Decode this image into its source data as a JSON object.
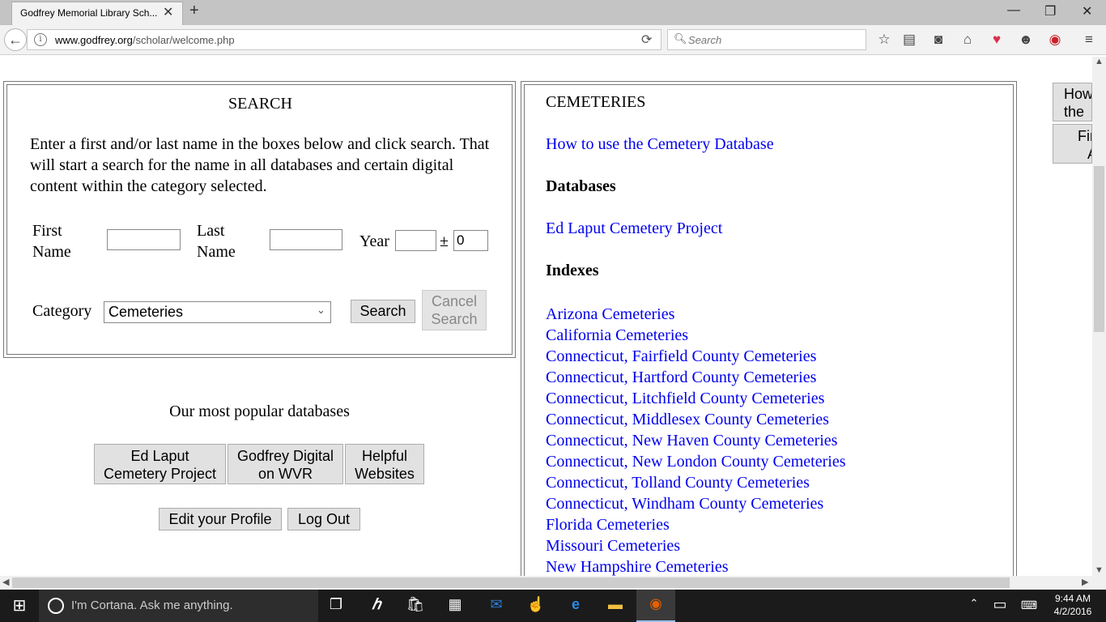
{
  "browser": {
    "tab_title": "Godfrey Memorial Library Sch...",
    "tab_close": "✕",
    "new_tab": "+",
    "url_domain": "www.godfrey.org",
    "url_path": "/scholar/welcome.php",
    "search_placeholder": "Search",
    "window_controls": {
      "minimize": "—",
      "restore": "❐",
      "close": "✕"
    }
  },
  "search_panel": {
    "title": "SEARCH",
    "instructions": "Enter a first and/or last name in the boxes below and click search. That will start a search for the name in all databases and certain digital content within the category selected.",
    "first_name_label_1": "First",
    "first_name_label_2": "Name",
    "first_name_value": "",
    "last_name_label_1": "Last",
    "last_name_label_2": "Name",
    "last_name_value": "",
    "year_label": "Year",
    "year_value": "",
    "plusminus": "±",
    "year_range_value": "0",
    "category_label": "Category",
    "category_selected": "Cemeteries",
    "search_button": "Search",
    "cancel_button_1": "Cancel",
    "cancel_button_2": "Search"
  },
  "popular": {
    "heading": "Our most popular databases",
    "btn1_line1": "Ed Laput",
    "btn1_line2": "Cemetery Project",
    "btn2_line1": "Godfrey Digital",
    "btn2_line2": "on WVR",
    "btn3_line1": "Helpful",
    "btn3_line2": "Websites",
    "edit_profile": "Edit your Profile",
    "log_out": "Log Out"
  },
  "cemeteries": {
    "title": "CEMETERIES",
    "how_to_link": "How to use the Cemetery Database",
    "databases_heading": "Databases",
    "databases": [
      "Ed Laput Cemetery Project"
    ],
    "indexes_heading": "Indexes",
    "indexes": [
      "Arizona Cemeteries",
      "California Cemeteries",
      "Connecticut, Fairfield County Cemeteries",
      "Connecticut, Hartford County Cemeteries",
      "Connecticut, Litchfield County Cemeteries",
      "Connecticut, Middlesex County Cemeteries",
      "Connecticut, New Haven County Cemeteries",
      "Connecticut, New London County Cemeteries",
      "Connecticut, Tolland County Cemeteries",
      "Connecticut, Windham County Cemeteries",
      "Florida Cemeteries",
      "Missouri Cemeteries",
      "New Hampshire Cemeteries"
    ]
  },
  "sidebar": {
    "btn1_line1": "How",
    "btn1_line2": "the S",
    "btn2_line1": "Fir",
    "btn2_line2": "A"
  },
  "taskbar": {
    "cortana_text": "I'm Cortana. Ask me anything.",
    "time": "9:44 AM",
    "date": "4/2/2016"
  }
}
